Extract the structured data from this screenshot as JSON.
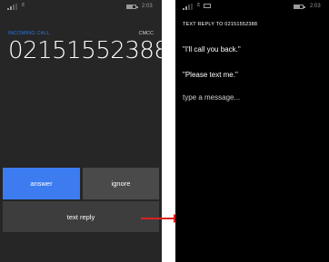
{
  "incoming_screen": {
    "status": {
      "time": "2:03"
    },
    "incoming_label": "INCOMING CALL",
    "carrier": "CMCC",
    "phone_number": "02151552388",
    "buttons": {
      "answer": "answer",
      "ignore": "ignore",
      "text_reply": "text reply"
    }
  },
  "reply_screen": {
    "status": {
      "time": "2:03"
    },
    "title": "TEXT REPLY TO 02151552388",
    "options": [
      "\"I'll call you back.\"",
      "\"Please text me.\""
    ],
    "type_message": "type a message..."
  },
  "colors": {
    "accent": "#3c7cf0",
    "arrow": "#e02020"
  }
}
